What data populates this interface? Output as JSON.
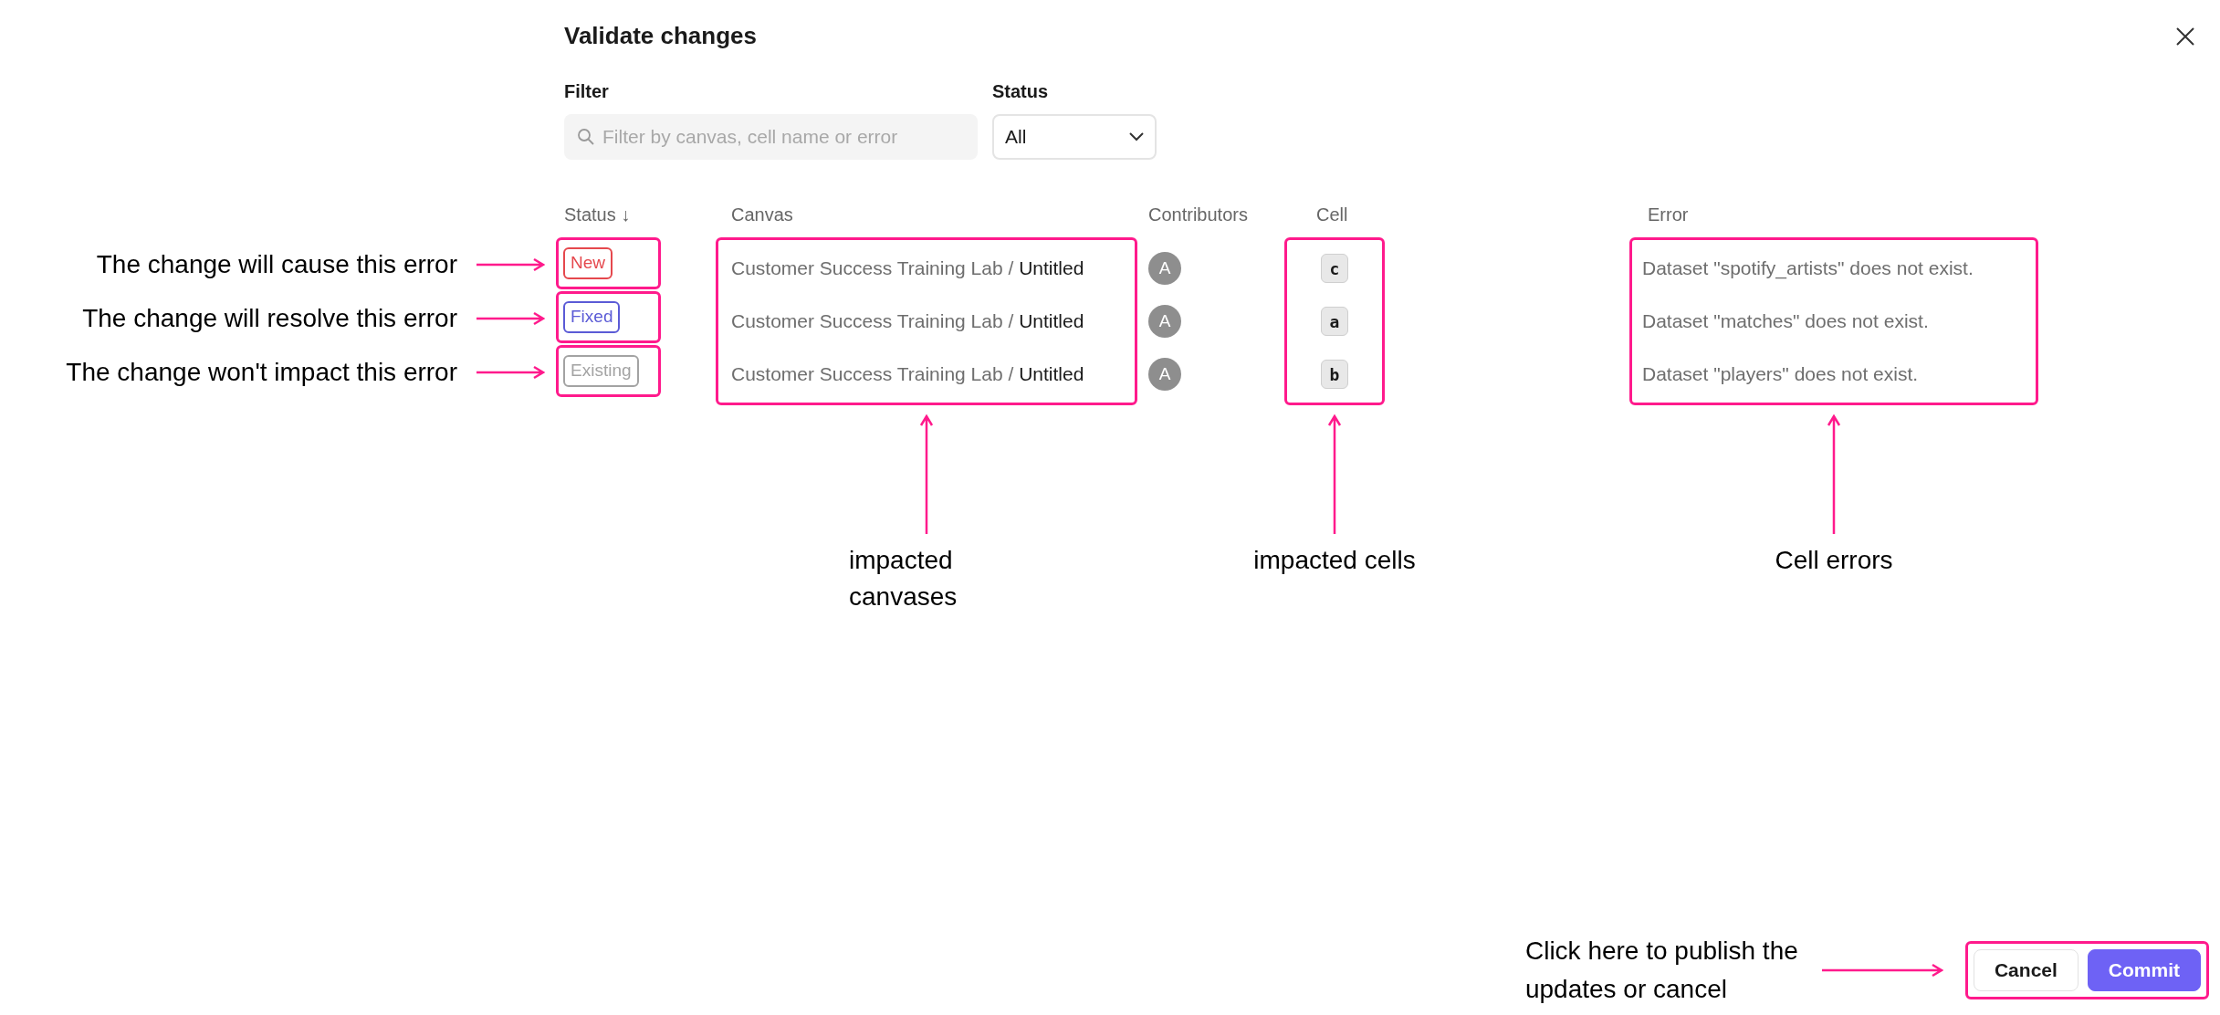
{
  "dialog": {
    "title": "Validate changes"
  },
  "filter": {
    "label": "Filter",
    "placeholder": "Filter by canvas, cell name or error"
  },
  "status_filter": {
    "label": "Status",
    "value": "All"
  },
  "table": {
    "columns": [
      "Status ↓",
      "Canvas",
      "Contributors",
      "Cell",
      "Error"
    ],
    "rows": [
      {
        "status": "New",
        "kind": "new",
        "canvas": "Customer Success Training Lab / **Untitled**",
        "contributor": "A",
        "cell": "c",
        "error": "Dataset \"spotify_artists\" does not exist."
      },
      {
        "status": "Fixed",
        "kind": "fixed",
        "canvas": "Customer Success Training Lab / **Untitled**",
        "contributor": "A",
        "cell": "a",
        "error": "Dataset \"matches\" does not exist."
      },
      {
        "status": "Existing",
        "kind": "existing",
        "canvas": "Customer Success Training Lab / **Untitled**",
        "contributor": "A",
        "cell": "b",
        "error": "Dataset \"players\" does not exist."
      }
    ]
  },
  "annotations": {
    "rows": [
      "The change will cause this error",
      "The change will resolve this error",
      "The change won't impact this error"
    ],
    "canvas": "impacted canvases",
    "cells": "impacted cells",
    "errors": "Cell errors",
    "buttons": "Click here to publish the updates or cancel"
  },
  "buttons": [
    {
      "label": "Cancel",
      "kind": "secondary"
    },
    {
      "label": "Commit",
      "kind": "primary"
    }
  ]
}
